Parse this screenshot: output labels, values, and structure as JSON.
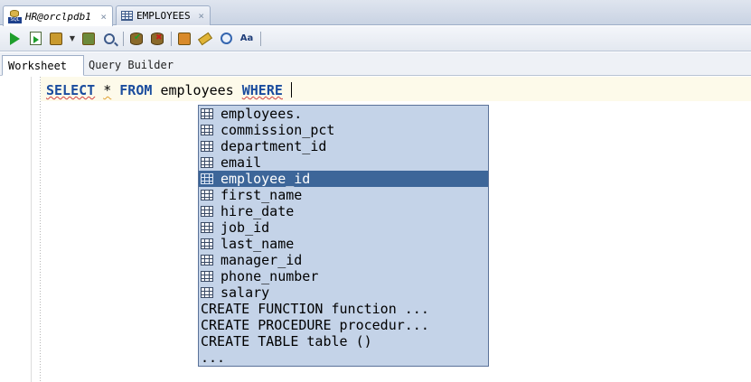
{
  "tabs": [
    {
      "label": "HR@orclpdb1",
      "icon": "sql-worksheet-icon",
      "active": true
    },
    {
      "label": "EMPLOYEES",
      "icon": "table-icon",
      "active": false
    }
  ],
  "tab_close_glyph": "×",
  "toolbar": {
    "buttons": [
      "run-statement-icon",
      "run-script-icon",
      "commit-icon",
      "dropdown-chevron-icon",
      "autotrace-icon",
      "explain-plan-icon",
      "commit-db-icon",
      "rollback-db-icon",
      "sql-tuning-icon",
      "clear-eraser-icon",
      "sql-history-icon",
      "format-case-icon"
    ]
  },
  "subtabs": [
    {
      "label": "Worksheet",
      "active": true
    },
    {
      "label": "Query Builder",
      "active": false
    }
  ],
  "editor": {
    "kw_select": "SELECT",
    "star": "*",
    "kw_from": "FROM",
    "table": "employees",
    "kw_where": "WHERE"
  },
  "completion": {
    "items": [
      {
        "label": "employees.",
        "icon": true
      },
      {
        "label": "commission_pct",
        "icon": true
      },
      {
        "label": "department_id",
        "icon": true
      },
      {
        "label": "email",
        "icon": true
      },
      {
        "label": "employee_id",
        "icon": true,
        "selected": true
      },
      {
        "label": "first_name",
        "icon": true
      },
      {
        "label": "hire_date",
        "icon": true
      },
      {
        "label": "job_id",
        "icon": true
      },
      {
        "label": "last_name",
        "icon": true
      },
      {
        "label": "manager_id",
        "icon": true
      },
      {
        "label": "phone_number",
        "icon": true
      },
      {
        "label": "salary",
        "icon": true
      },
      {
        "label": "CREATE FUNCTION function ...",
        "icon": false
      },
      {
        "label": "CREATE PROCEDURE procedur...",
        "icon": false
      },
      {
        "label": "CREATE TABLE table ()",
        "icon": false
      },
      {
        "label": "...",
        "icon": false
      }
    ]
  }
}
